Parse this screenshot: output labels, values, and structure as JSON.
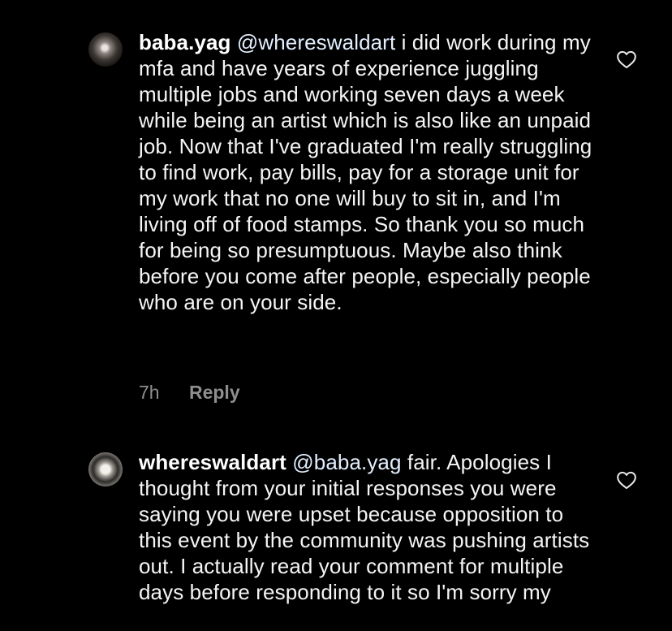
{
  "comments": [
    {
      "username": "baba.yag",
      "mention": "@whereswaldart",
      "text": "i did work during my mfa and have years of experience juggling multiple jobs and working seven days a week while being an artist which is also like an unpaid job. Now that I've graduated I'm really struggling to find work, pay bills, pay for a storage unit for my work that no one will buy to sit in, and I'm living off of food stamps. So thank you so much for being so presumptuous. Maybe also think before you come after people, especially people who are on your side.",
      "time": "7h",
      "reply_label": "Reply",
      "like_icon": "heart-outline-icon"
    },
    {
      "username": "whereswaldart",
      "mention": "@baba.yag",
      "text": "fair. Apologies I thought from your initial responses you were saying you were upset because opposition to this event by the community was pushing artists out. I actually read your comment for multiple days before responding to it so I'm sorry my",
      "like_icon": "heart-outline-icon"
    }
  ],
  "colors": {
    "background": "#000000",
    "text": "#f5f5f5",
    "secondary": "#8e8e8e",
    "mention": "#e0f1ff"
  }
}
